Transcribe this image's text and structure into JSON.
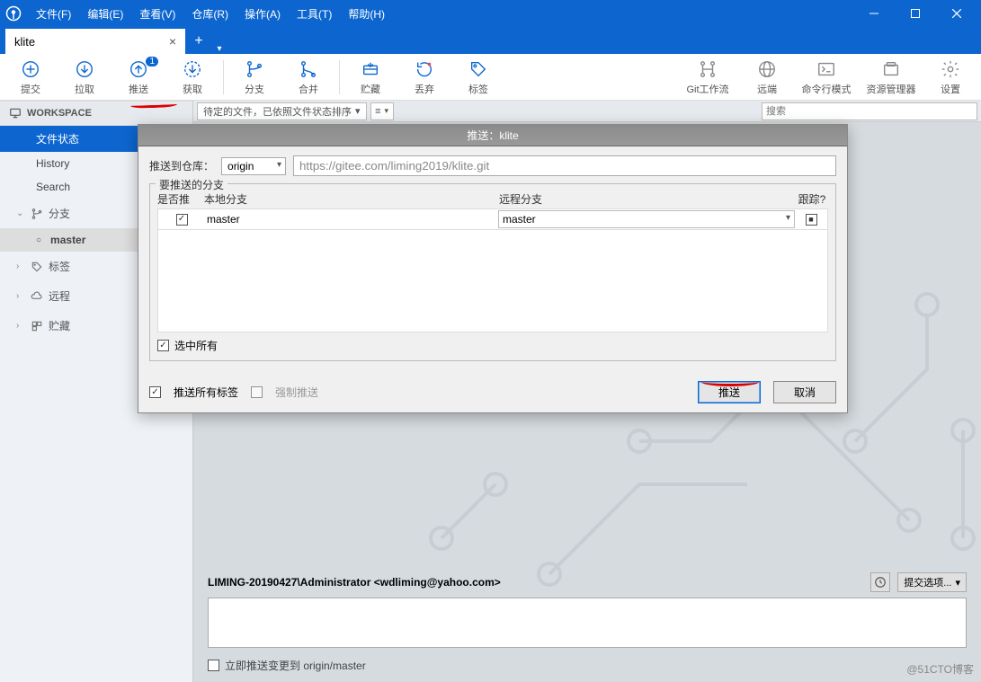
{
  "menu": {
    "file": "文件(F)",
    "edit": "编辑(E)",
    "view": "查看(V)",
    "repo": "仓库(R)",
    "action": "操作(A)",
    "tools": "工具(T)",
    "help": "帮助(H)"
  },
  "tab": {
    "name": "klite"
  },
  "toolbar": {
    "commit": "提交",
    "pull": "拉取",
    "push": "推送",
    "fetch": "获取",
    "branch": "分支",
    "merge": "合并",
    "stash": "贮藏",
    "discard": "丢弃",
    "tag": "标签",
    "gitflow": "Git工作流",
    "remote": "远端",
    "terminal": "命令行模式",
    "explorer": "资源管理器",
    "settings": "设置",
    "push_badge": "1"
  },
  "sidebar": {
    "workspace": "WORKSPACE",
    "filestatus": "文件状态",
    "history": "History",
    "search": "Search",
    "branches": "分支",
    "master": "master",
    "tags": "标签",
    "remotes": "远程",
    "stashes": "贮藏"
  },
  "filter": {
    "pending": "待定的文件，已依照文件状态排序",
    "search_ph": "搜索"
  },
  "dialog": {
    "title": "推送：klite",
    "push_to": "推送到仓库：",
    "remote": "origin",
    "url": "https://gitee.com/liming2019/klite.git",
    "legend": "要推送的分支",
    "col_push": "是否推",
    "col_local": "本地分支",
    "col_remote": "远程分支",
    "col_track": "跟踪?",
    "row_local": "master",
    "row_remote": "master",
    "select_all": "选中所有",
    "push_all_tags": "推送所有标签",
    "force": "强制推送",
    "btn_push": "推送",
    "btn_cancel": "取消"
  },
  "commit": {
    "user": "LIMING-20190427\\Administrator <wdliming@yahoo.com>",
    "options": "提交选项...",
    "push_now": "立即推送变更到 origin/master"
  },
  "watermark": "@51CTO博客"
}
